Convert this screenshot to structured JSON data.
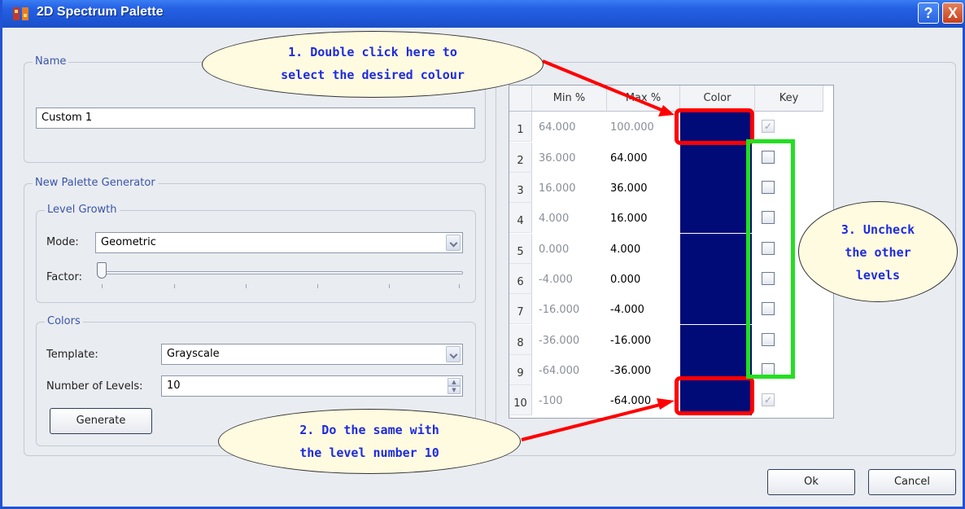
{
  "window": {
    "title": "2D Spectrum Palette",
    "help_label": "?",
    "close_label": "X"
  },
  "name_group": {
    "legend": "Name",
    "value": "Custom 1"
  },
  "generator": {
    "legend": "New Palette Generator",
    "level_growth": {
      "legend": "Level Growth",
      "mode_label": "Mode:",
      "mode_value": "Geometric",
      "factor_label": "Factor:",
      "factor_position": 0
    },
    "colors": {
      "legend": "Colors",
      "template_label": "Template:",
      "template_value": "Grayscale",
      "levels_label": "Number of Levels:",
      "levels_value": "10",
      "generate_label": "Generate"
    }
  },
  "table": {
    "headers": {
      "min": "Min %",
      "max": "Max %",
      "color": "Color",
      "key": "Key"
    },
    "rows": [
      {
        "n": "1",
        "min": "64.000",
        "max": "100.000",
        "key": true
      },
      {
        "n": "2",
        "min": "36.000",
        "max": "64.000",
        "key": false
      },
      {
        "n": "3",
        "min": "16.000",
        "max": "36.000",
        "key": false
      },
      {
        "n": "4",
        "min": "4.000",
        "max": "16.000",
        "key": false
      },
      {
        "n": "5",
        "min": "0.000",
        "max": "4.000",
        "key": false
      },
      {
        "n": "6",
        "min": "-4.000",
        "max": "0.000",
        "key": false
      },
      {
        "n": "7",
        "min": "-16.000",
        "max": "-4.000",
        "key": false
      },
      {
        "n": "8",
        "min": "-36.000",
        "max": "-16.000",
        "key": false
      },
      {
        "n": "9",
        "min": "-64.000",
        "max": "-36.000",
        "key": false
      },
      {
        "n": "10",
        "min": "-100",
        "max": "-64.000",
        "key": true
      }
    ],
    "color_hex": "#000b78"
  },
  "footer": {
    "ok_label": "Ok",
    "cancel_label": "Cancel"
  },
  "annotations": {
    "bubble1": [
      "1. Double click here to",
      "select the desired colour"
    ],
    "bubble2": [
      "2. Do the same with",
      "the level number 10"
    ],
    "bubble3": [
      "3. Uncheck",
      "the other",
      "levels"
    ]
  },
  "colors": {
    "title_bar": "#2561e5",
    "highlight_red": "#ff0000",
    "highlight_green": "#22e020",
    "bubble_text": "#1d2be0"
  }
}
